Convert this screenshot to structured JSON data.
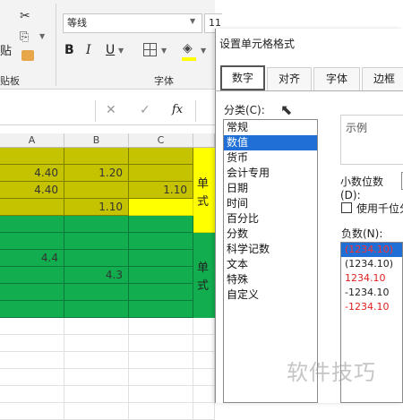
{
  "ribbon": {
    "font_name": "等线",
    "font_size": "11",
    "paste_label": "贴",
    "clipboard_label": "贴板",
    "font_group_label": "字体"
  },
  "formula_bar": {
    "fx_label": "fx"
  },
  "grid": {
    "columns": [
      "A",
      "B",
      "C"
    ],
    "rows": [
      [
        "",
        "",
        ""
      ],
      [
        "4.40",
        "1.20",
        ""
      ],
      [
        "4.40",
        "",
        "1.10"
      ],
      [
        "",
        "1.10",
        ""
      ],
      [
        "",
        "",
        ""
      ],
      [
        "",
        "",
        ""
      ],
      [
        "4.4",
        "",
        ""
      ],
      [
        "",
        "4.3",
        ""
      ],
      [
        "",
        "",
        ""
      ],
      [
        "",
        "",
        ""
      ]
    ],
    "side_label_1": "单\n式",
    "side_label_2": "单\n式"
  },
  "dialog": {
    "title": "设置单元格格式",
    "tabs": [
      "数字",
      "对齐",
      "字体",
      "边框"
    ],
    "category_label": "分类(C):",
    "categories": [
      "常规",
      "数值",
      "货币",
      "会计专用",
      "日期",
      "时间",
      "百分比",
      "分数",
      "科学记数",
      "文本",
      "特殊",
      "自定义"
    ],
    "selected_category_index": 1,
    "sample_label": "示例",
    "decimal_label": "小数位数(D):",
    "thousands_label": "使用千位分",
    "negative_label": "负数(N):",
    "negative_options": [
      {
        "text": "(1234.10)",
        "color": "#ff3030",
        "selected": true
      },
      {
        "text": "(1234.10)",
        "color": "#222222",
        "selected": false
      },
      {
        "text": "1234.10",
        "color": "#e02020",
        "selected": false
      },
      {
        "text": "-1234.10",
        "color": "#222222",
        "selected": false
      },
      {
        "text": "-1234.10",
        "color": "#e02020",
        "selected": false
      }
    ]
  },
  "watermark": "软件技巧",
  "colors": {
    "olive": "#c5c200",
    "green": "#12ad4e",
    "yellow": "#ffff00",
    "selection": "#1f6fd6"
  }
}
